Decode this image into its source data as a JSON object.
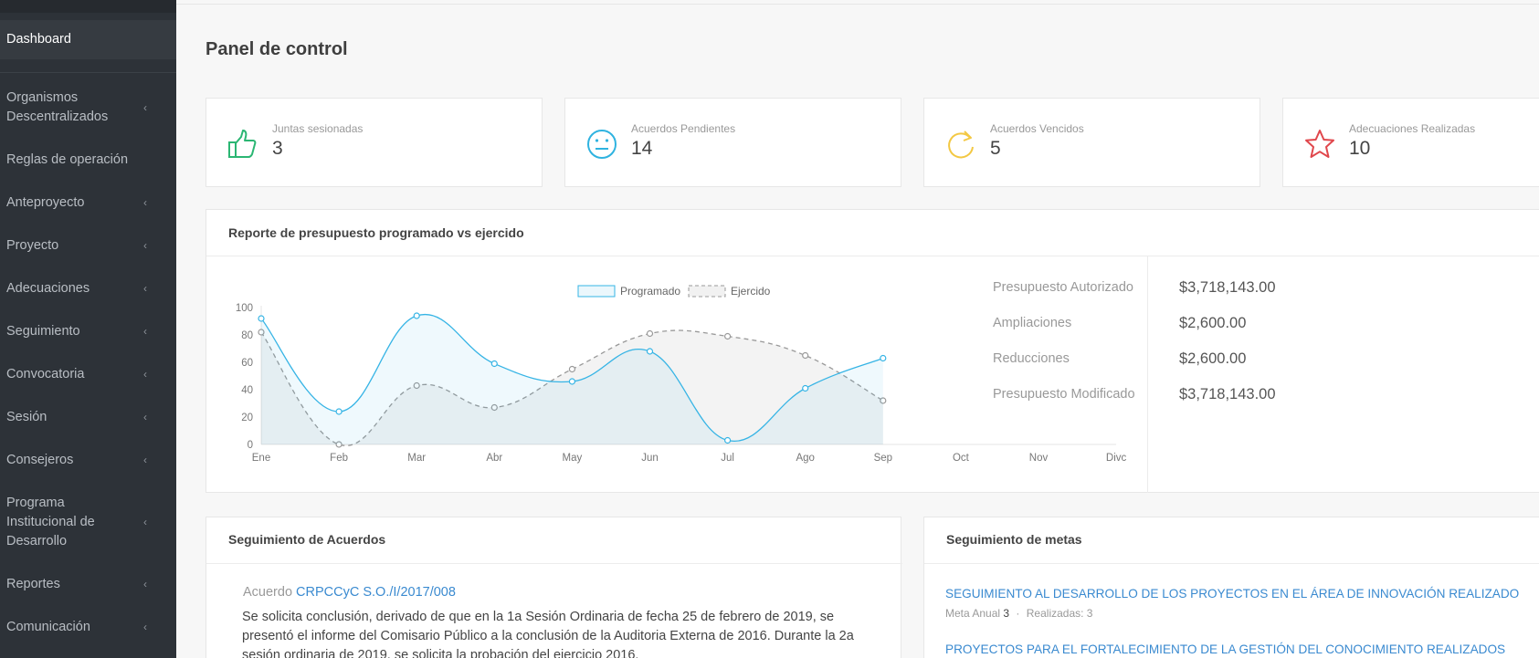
{
  "sidebar": {
    "items": [
      {
        "label": "Dashboard",
        "chevron": false,
        "active": true
      },
      {
        "label": "Organismos Descentralizados",
        "chevron": true
      },
      {
        "label": "Reglas de operación",
        "chevron": false
      },
      {
        "label": "Anteproyecto",
        "chevron": true
      },
      {
        "label": "Proyecto",
        "chevron": true
      },
      {
        "label": "Adecuaciones",
        "chevron": true
      },
      {
        "label": "Seguimiento",
        "chevron": true
      },
      {
        "label": "Convocatoria",
        "chevron": true
      },
      {
        "label": "Sesión",
        "chevron": true
      },
      {
        "label": "Consejeros",
        "chevron": true
      },
      {
        "label": "Programa Institucional de Desarrollo",
        "chevron": true
      },
      {
        "label": "Reportes",
        "chevron": true
      },
      {
        "label": "Comunicación",
        "chevron": true
      }
    ],
    "chevron_glyph": "‹"
  },
  "page": {
    "title": "Panel de control"
  },
  "stats": [
    {
      "label": "Juntas sesionadas",
      "value": "3",
      "icon": "thumbs-up-icon",
      "color": "#2bb673"
    },
    {
      "label": "Acuerdos Pendientes",
      "value": "14",
      "icon": "neutral-face-icon",
      "color": "#2fb3e0"
    },
    {
      "label": "Acuerdos Vencidos",
      "value": "5",
      "icon": "refresh-icon",
      "color": "#f3c843"
    },
    {
      "label": "Adecuaciones Realizadas",
      "value": "10",
      "icon": "star-icon",
      "color": "#e0474c"
    }
  ],
  "report": {
    "title": "Reporte de presupuesto programado vs ejercido",
    "budget": [
      {
        "label": "Presupuesto Autorizado",
        "value": "$3,718,143.00"
      },
      {
        "label": "Ampliaciones",
        "value": "$2,600.00"
      },
      {
        "label": "Reducciones",
        "value": "$2,600.00"
      },
      {
        "label": "Presupuesto Modificado",
        "value": "$3,718,143.00"
      }
    ]
  },
  "chart_data": {
    "type": "area",
    "categories": [
      "Ene",
      "Feb",
      "Mar",
      "Abr",
      "May",
      "Jun",
      "Jul",
      "Ago",
      "Sep",
      "Oct",
      "Nov",
      "Divc"
    ],
    "series": [
      {
        "name": "Programado",
        "values": [
          92,
          24,
          94,
          59,
          46,
          68,
          3,
          41,
          63
        ],
        "color": "#36b4e5",
        "style": "solid"
      },
      {
        "name": "Ejercido",
        "values": [
          82,
          0,
          43,
          27,
          55,
          81,
          79,
          65,
          32
        ],
        "color": "#999999",
        "style": "dashed"
      }
    ],
    "yticks": [
      0,
      20,
      40,
      60,
      80,
      100
    ],
    "ylim": [
      0,
      100
    ],
    "legend": "top-center"
  },
  "acuerdos": {
    "title": "Seguimiento de Acuerdos",
    "prefix": "Acuerdo",
    "code": "CRPCCyC S.O./I/2017/008",
    "text": "Se solicita conclusión, derivado de que en la 1a Sesión Ordinaria de fecha 25 de febrero de 2019, se presentó el informe del Comisario Público a la conclusión de la Auditoria Externa de 2016. Durante la 2a sesión ordinaria de 2019, se solicita la probación del ejercicio 2016."
  },
  "metas": {
    "title": "Seguimiento de metas",
    "items": [
      {
        "title": "SEGUIMIENTO AL DESARROLLO DE LOS PROYECTOS EN EL ÁREA DE INNOVACIÓN REALIZADO",
        "meta_label": "Meta Anual",
        "meta_value": "3",
        "sep": "·",
        "realizadas": "Realizadas: 3"
      },
      {
        "title": "PROYECTOS PARA EL FORTALECIMIENTO DE LA GESTIÓN DEL CONOCIMIENTO REALIZADOS"
      }
    ]
  }
}
